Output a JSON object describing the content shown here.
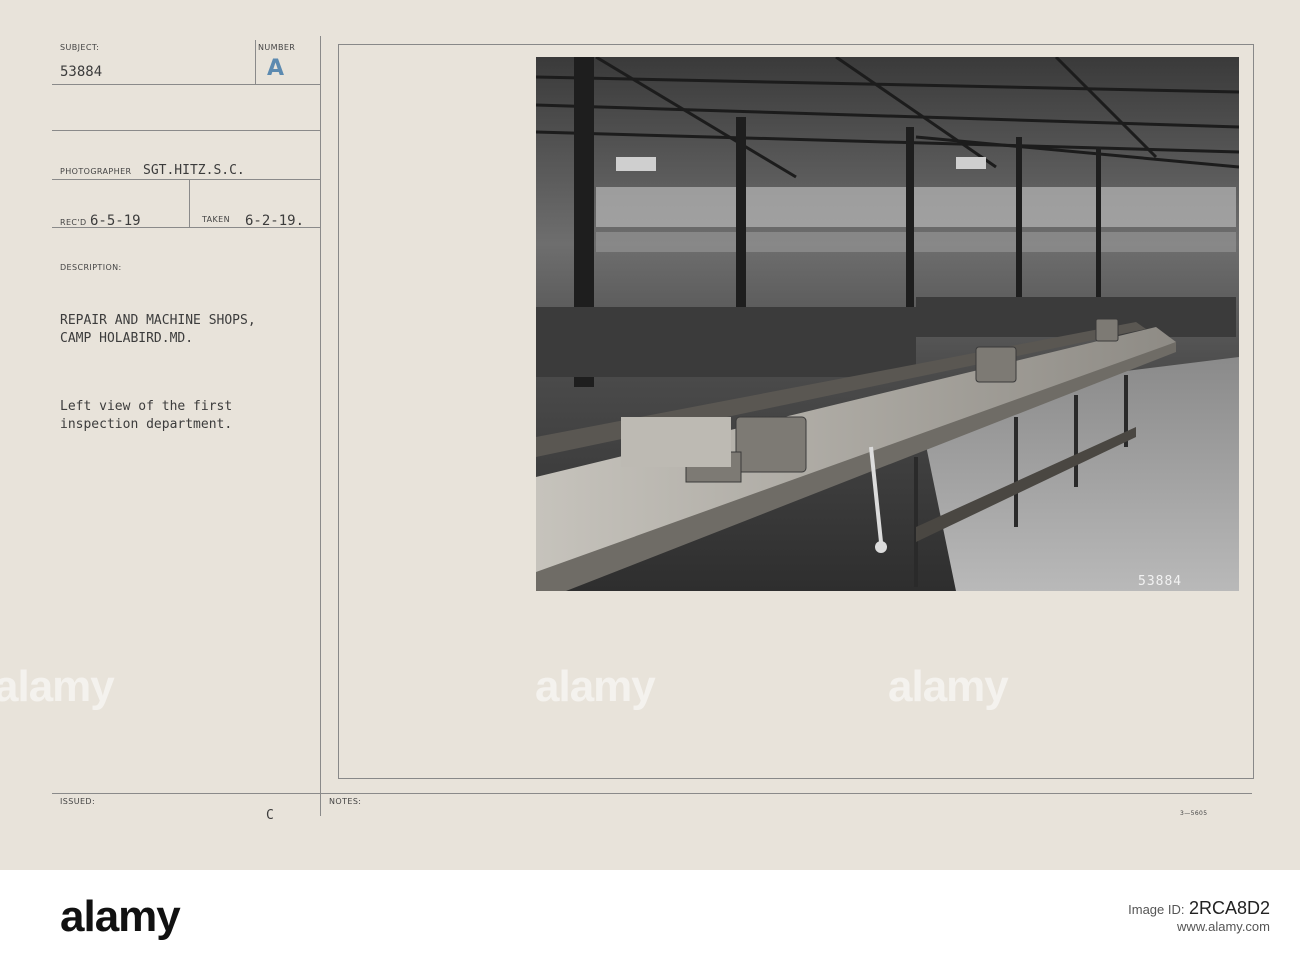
{
  "card": {
    "subject_label": "SUBJECT:",
    "subject_value": "53884",
    "number_label": "NUMBER",
    "number_value": "A",
    "photographer_label": "PHOTOGRAPHER",
    "photographer_value": "SGT.HITZ.S.C.",
    "recd_label": "REC'D",
    "recd_value": "6-5-19",
    "taken_label": "TAKEN",
    "taken_value": "6-2-19.",
    "description_label": "DESCRIPTION:",
    "description_line1": "REPAIR AND MACHINE SHOPS,",
    "description_line2": "CAMP HOLABIRD.MD.",
    "note_line1": "Left view of the first",
    "note_line2": "inspection department.",
    "issued_label": "ISSUED:",
    "issued_value": "C",
    "notes_label": "NOTES:",
    "form_code": "3—5605"
  },
  "photo": {
    "number_stamp": "53884"
  },
  "watermark": {
    "text": "alamy"
  },
  "footer": {
    "logo": "alamy",
    "image_id_label": "Image ID:",
    "image_id": "2RCA8D2",
    "url": "www.alamy.com"
  }
}
